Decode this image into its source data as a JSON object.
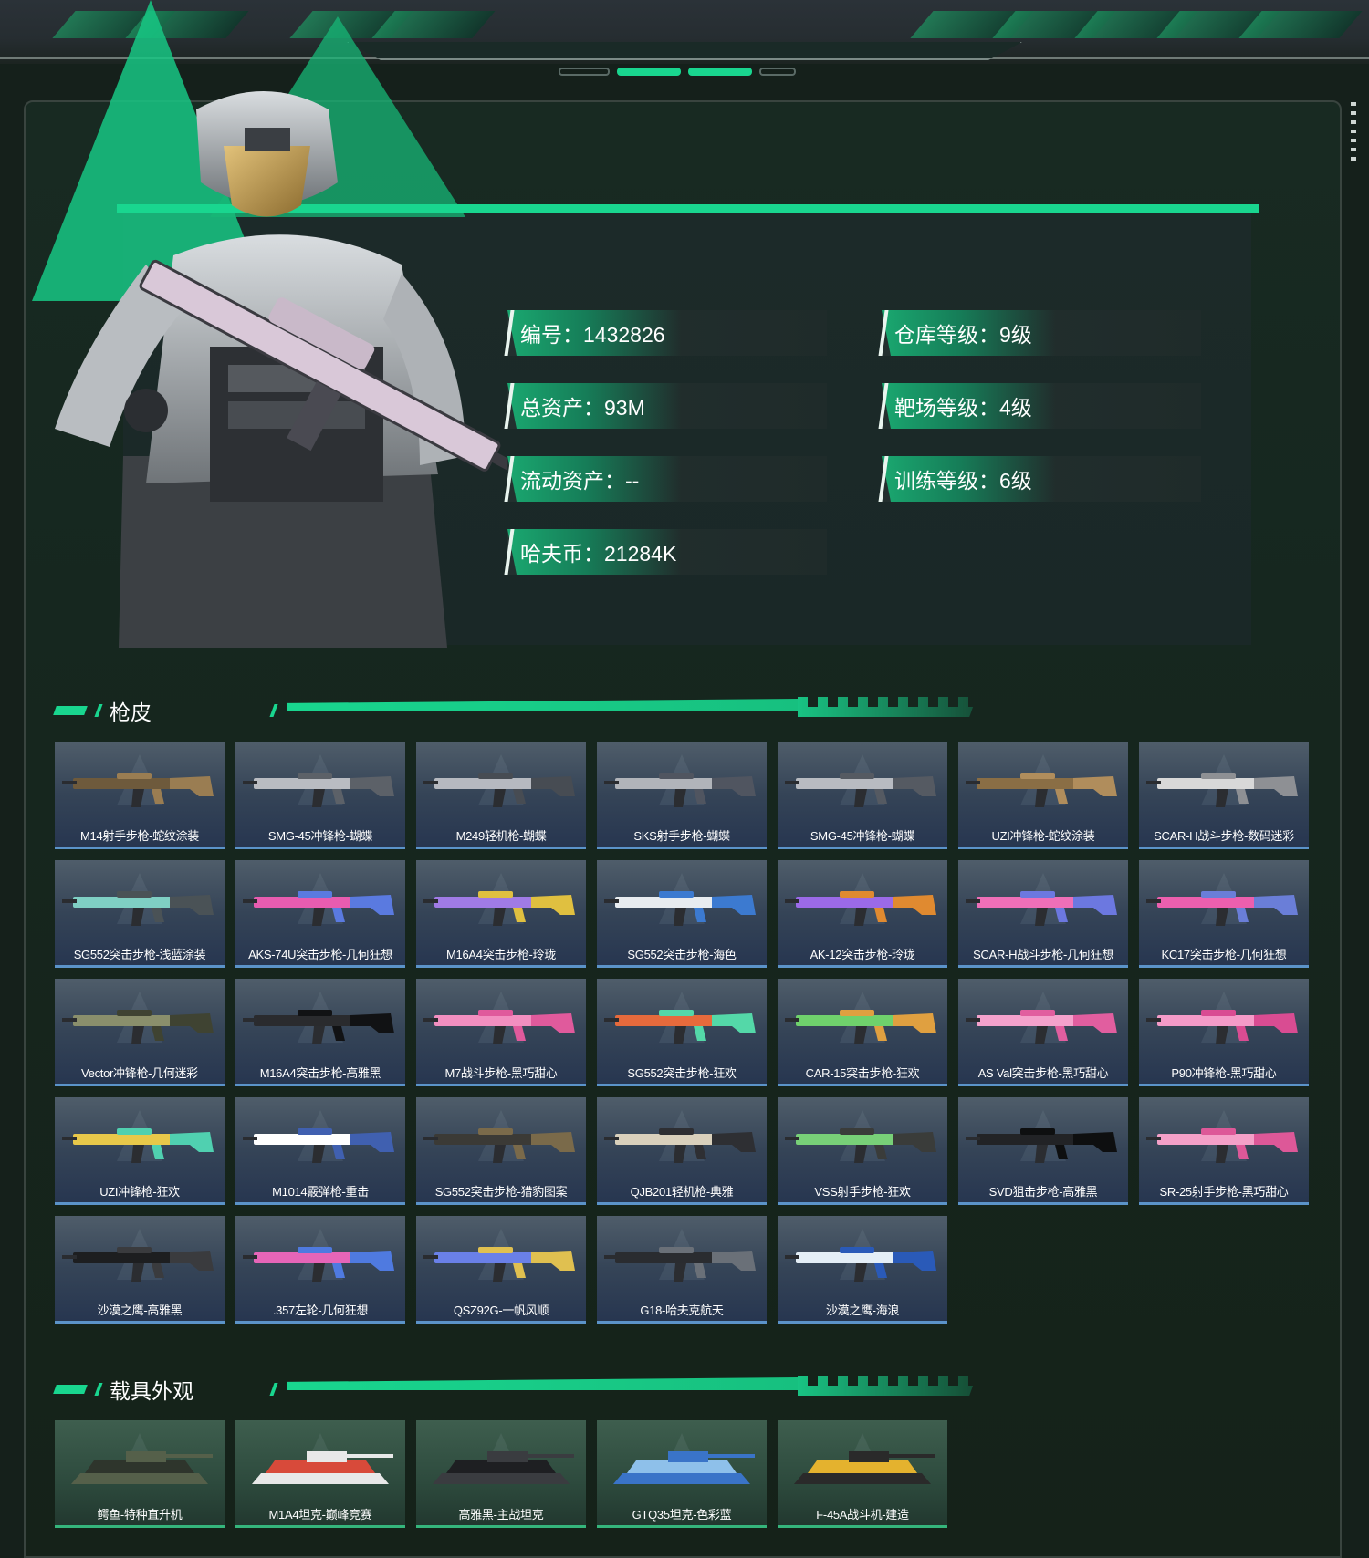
{
  "player": {
    "fields": [
      {
        "label": "编号：1432826"
      },
      {
        "label": "仓库等级：9级"
      },
      {
        "label": "总资产：93M"
      },
      {
        "label": "靶场等级：4级"
      },
      {
        "label": "流动资产：--"
      },
      {
        "label": "训练等级：6级"
      },
      {
        "label": "哈夫币：21284K"
      }
    ]
  },
  "sections": {
    "skins_title": "枪皮",
    "vehicles_title": "载具外观"
  },
  "skins": [
    {
      "name": "M14射手步枪-蛇纹涂装",
      "colors": [
        "#6e5a3c",
        "#9a7d52"
      ]
    },
    {
      "name": "SMG-45冲锋枪-蝴蝶",
      "colors": [
        "#b9bcc2",
        "#5c6168"
      ]
    },
    {
      "name": "M249轻机枪-蝴蝶",
      "colors": [
        "#b6b9c0",
        "#474c53"
      ]
    },
    {
      "name": "SKS射手步枪-蝴蝶",
      "colors": [
        "#b1b4ba",
        "#505560"
      ]
    },
    {
      "name": "SMG-45冲锋枪-蝴蝶",
      "colors": [
        "#b8bbc1",
        "#555a62"
      ]
    },
    {
      "name": "UZI冲锋枪-蛇纹涂装",
      "colors": [
        "#8a6e45",
        "#b08d5c"
      ]
    },
    {
      "name": "SCAR-H战斗步枪-数码迷彩",
      "colors": [
        "#d8d8d8",
        "#8e9094"
      ]
    },
    {
      "name": "SG552突击步枪-浅蓝涂装",
      "colors": [
        "#7fcfc4",
        "#4a5256"
      ]
    },
    {
      "name": "AKS-74U突击步枪-几何狂想",
      "colors": [
        "#e85cb0",
        "#5a7ae0"
      ]
    },
    {
      "name": "M16A4突击步枪-玲珑",
      "colors": [
        "#a07be6",
        "#e0c040"
      ]
    },
    {
      "name": "SG552突击步枪-海色",
      "colors": [
        "#e8ecf0",
        "#3c7ad0"
      ]
    },
    {
      "name": "AK-12突击步枪-玲珑",
      "colors": [
        "#9b6ae8",
        "#e08a30"
      ]
    },
    {
      "name": "SCAR-H战斗步枪-几何狂想",
      "colors": [
        "#ef6fb8",
        "#6c78e0"
      ]
    },
    {
      "name": "KC17突击步枪-几何狂想",
      "colors": [
        "#ec5fae",
        "#6a7ed8"
      ]
    },
    {
      "name": "Vector冲锋枪-几何迷彩",
      "colors": [
        "#8a8f6c",
        "#3f4332"
      ]
    },
    {
      "name": "M16A4突击步枪-高雅黑",
      "colors": [
        "#2a2b2e",
        "#111214"
      ]
    },
    {
      "name": "M7战斗步枪-黑巧甜心",
      "colors": [
        "#f28fc0",
        "#e05a9c"
      ]
    },
    {
      "name": "SG552突击步枪-狂欢",
      "colors": [
        "#e66a3c",
        "#54d8a8"
      ]
    },
    {
      "name": "CAR-15突击步枪-狂欢",
      "colors": [
        "#6fd16c",
        "#e0a040"
      ]
    },
    {
      "name": "AS Val突击步枪-黑巧甜心",
      "colors": [
        "#f4a2cc",
        "#e15e9f"
      ]
    },
    {
      "name": "P90冲锋枪-黑巧甜心",
      "colors": [
        "#f49bc8",
        "#d94c92"
      ]
    },
    {
      "name": "UZI冲锋枪-狂欢",
      "colors": [
        "#e8c84a",
        "#50d0b0"
      ]
    },
    {
      "name": "M1014霰弹枪-重击",
      "colors": [
        "#ffffff",
        "#4060b0"
      ]
    },
    {
      "name": "SG552突击步枪-猎豹图案",
      "colors": [
        "#3b3a36",
        "#7a6a4a"
      ]
    },
    {
      "name": "QJB201轻机枪-典雅",
      "colors": [
        "#d9d0bc",
        "#2e2f33"
      ]
    },
    {
      "name": "VSS射手步枪-狂欢",
      "colors": [
        "#78d078",
        "#3a3c3a"
      ]
    },
    {
      "name": "SVD狙击步枪-高雅黑",
      "colors": [
        "#222326",
        "#0e0f10"
      ]
    },
    {
      "name": "SR-25射手步枪-黑巧甜心",
      "colors": [
        "#f4a0c8",
        "#dd5898"
      ]
    },
    {
      "name": "沙漠之鹰-高雅黑",
      "colors": [
        "#1d1e20",
        "#3a3b3e"
      ]
    },
    {
      "name": ".357左轮-几何狂想",
      "colors": [
        "#e665b8",
        "#4f7ae0"
      ]
    },
    {
      "name": "QSZ92G-一帆风顺",
      "colors": [
        "#6a80e8",
        "#e0c050"
      ]
    },
    {
      "name": "G18-哈夫克航天",
      "colors": [
        "#2a2c30",
        "#6a7078"
      ]
    },
    {
      "name": "沙漠之鹰-海浪",
      "colors": [
        "#e4eef6",
        "#2a5ab8"
      ]
    }
  ],
  "vehicles": [
    {
      "name": "鳄鱼-特种直升机",
      "colors": [
        "#2e352c",
        "#55604a"
      ]
    },
    {
      "name": "M1A4坦克-巅峰竞赛",
      "colors": [
        "#d84a3a",
        "#e8e8e8"
      ]
    },
    {
      "name": "高雅黑-主战坦克",
      "colors": [
        "#1e1f22",
        "#3a3c40"
      ]
    },
    {
      "name": "GTQ35坦克-色彩蓝",
      "colors": [
        "#8ec0ea",
        "#3a74c8"
      ]
    },
    {
      "name": "F-45A战斗机-建造",
      "colors": [
        "#e4b22e",
        "#2a2a2a"
      ]
    }
  ],
  "icons": {
    "section_marker": "green-slash-marker-icon",
    "card_watermark": "triangle-logo-icon"
  },
  "theme": {
    "accent": "#19d68f",
    "panel_bg": "#16271f",
    "card_border": "#5b93c9"
  }
}
